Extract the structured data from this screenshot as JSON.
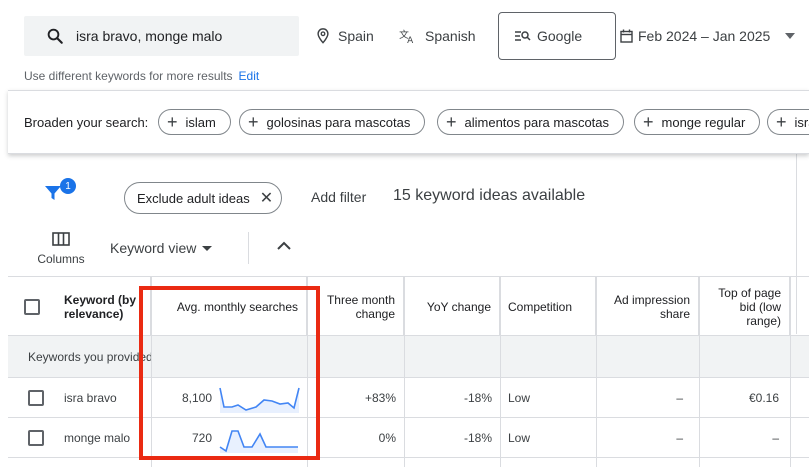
{
  "search": {
    "keywords": "isra bravo, monge malo",
    "location": "Spain",
    "language": "Spanish",
    "network": "Google",
    "date_range": "Feb 2024 – Jan 2025",
    "hint": "Use different keywords for more results",
    "edit_link": "Edit"
  },
  "broaden": {
    "label": "Broaden your search:",
    "chips": [
      "islam",
      "golosinas para mascotas",
      "alimentos para mascotas",
      "monge regular",
      "isra"
    ]
  },
  "filters": {
    "badge_count": "1",
    "exclude_chip": "Exclude adult ideas",
    "add_filter": "Add filter",
    "ideas_count": "15 keyword ideas available",
    "columns_label": "Columns",
    "view_label": "Keyword view"
  },
  "table": {
    "headers": {
      "keyword": "Keyword (by relevance)",
      "avg": "Avg. monthly searches",
      "three_month": "Three month change",
      "yoy": "YoY change",
      "competition": "Competition",
      "impression_share": "Ad impression share",
      "top_bid": "Top of page bid (low range)"
    },
    "group_label": "Keywords you provided",
    "rows": [
      {
        "keyword": "isra bravo",
        "avg": "8,100",
        "three_month": "+83%",
        "yoy": "-18%",
        "competition": "Low",
        "impression_share": "–",
        "top_bid": "€0.16"
      },
      {
        "keyword": "monge malo",
        "avg": "720",
        "three_month": "0%",
        "yoy": "-18%",
        "competition": "Low",
        "impression_share": "–",
        "top_bid": "–"
      }
    ]
  },
  "colors": {
    "accent": "#1a73e8",
    "highlight": "#ea2a12",
    "sparkline": "#4285f4"
  }
}
